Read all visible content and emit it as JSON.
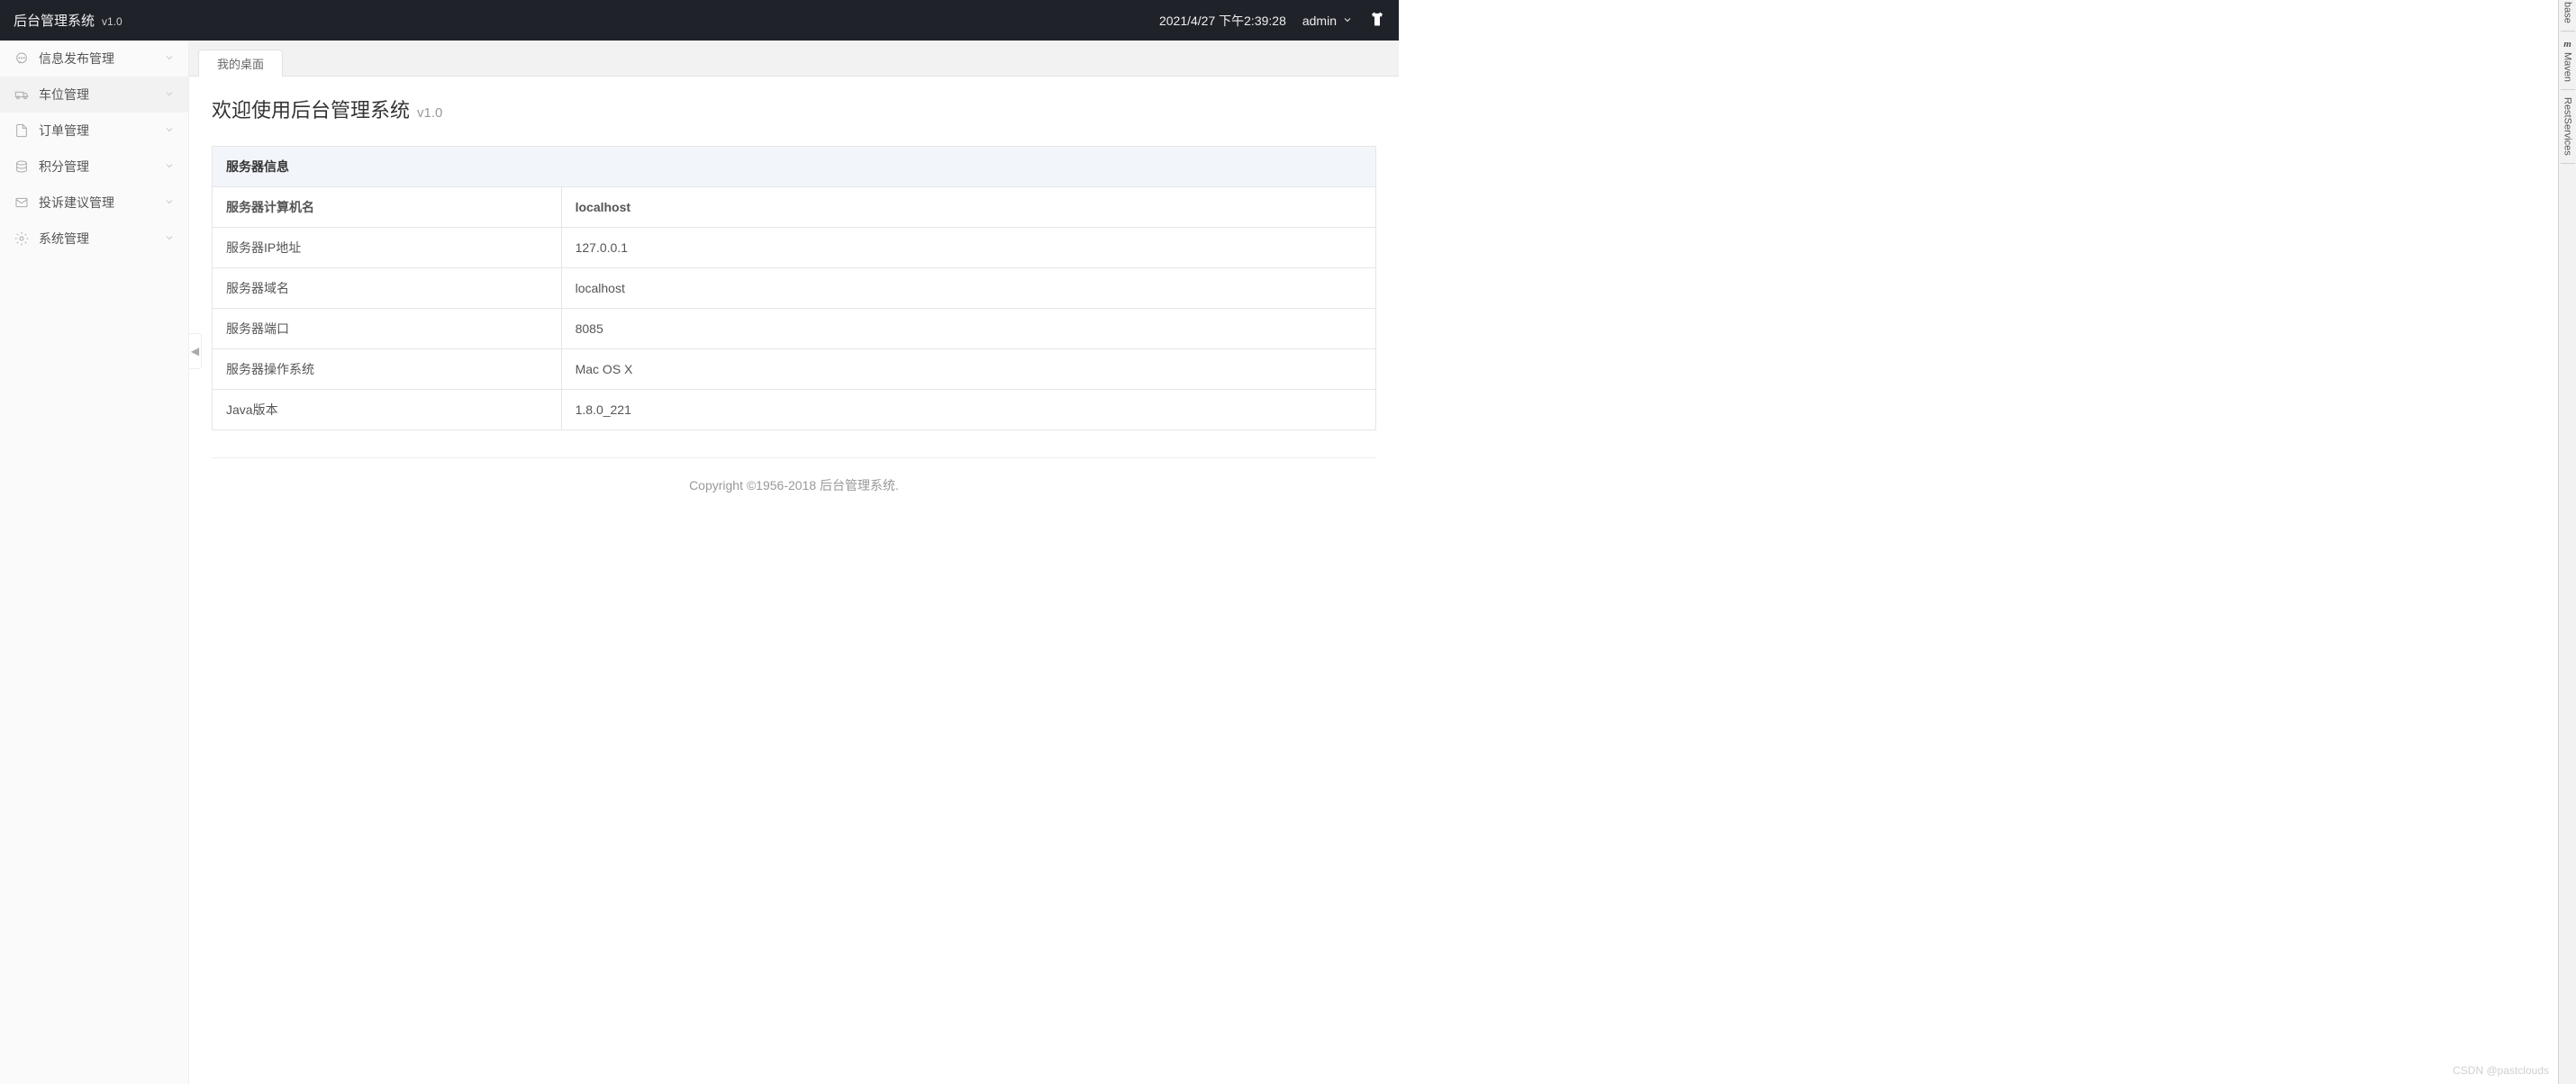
{
  "header": {
    "title": "后台管理系统",
    "version": "v1.0",
    "datetime": "2021/4/27 下午2:39:28",
    "user": "admin"
  },
  "sidebar": {
    "items": [
      {
        "icon": "chat",
        "label": "信息发布管理"
      },
      {
        "icon": "truck",
        "label": "车位管理"
      },
      {
        "icon": "file",
        "label": "订单管理"
      },
      {
        "icon": "stack",
        "label": "积分管理"
      },
      {
        "icon": "mail",
        "label": "投诉建议管理"
      },
      {
        "icon": "gear",
        "label": "系统管理"
      }
    ]
  },
  "tabs": {
    "active": "我的桌面"
  },
  "content": {
    "title": "欢迎使用后台管理系统",
    "title_version": "v1.0",
    "table_header": "服务器信息",
    "rows": [
      {
        "label": "服务器计算机名",
        "value": "localhost"
      },
      {
        "label": "服务器IP地址",
        "value": "127.0.0.1"
      },
      {
        "label": "服务器域名",
        "value": "localhost"
      },
      {
        "label": "服务器端口",
        "value": "8085"
      },
      {
        "label": "服务器操作系统",
        "value": "Mac OS X"
      },
      {
        "label": "Java版本",
        "value": "1.8.0_221"
      }
    ],
    "footer": "Copyright ©1956-2018 后台管理系统."
  },
  "ide_rail": {
    "items": [
      "base",
      "Maven",
      "RestServices"
    ]
  },
  "watermark": "CSDN @pastclouds"
}
